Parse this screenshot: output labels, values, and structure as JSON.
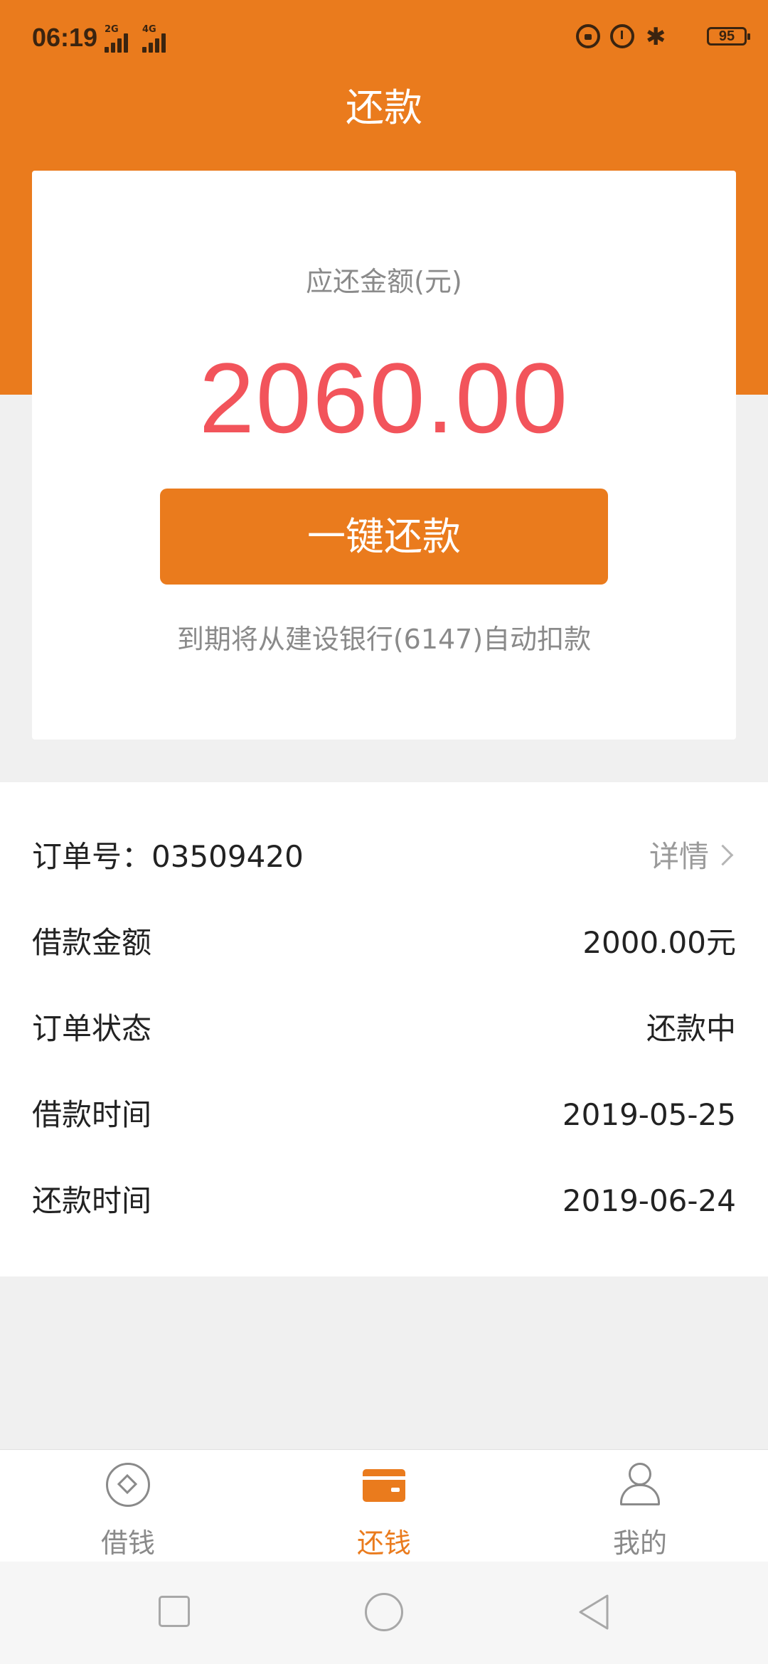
{
  "status_bar": {
    "time": "06:19",
    "signal_1_label": "2G",
    "signal_2_label": "4G",
    "battery": "95",
    "icons": [
      "lock-rotation-icon",
      "alarm-icon",
      "bluetooth-icon",
      "battery-icon"
    ]
  },
  "header": {
    "title": "还款"
  },
  "card": {
    "amount_label": "应还金额(元)",
    "amount_value": "2060.00",
    "button_label": "一键还款",
    "auto_debit_note": "到期将从建设银行(6147)自动扣款"
  },
  "order": {
    "order_no_label": "订单号：",
    "order_no": "03509420",
    "detail_link": "详情",
    "rows": [
      {
        "label": "借款金额",
        "value": "2000.00元"
      },
      {
        "label": "订单状态",
        "value": "还款中"
      },
      {
        "label": "借款时间",
        "value": "2019-05-25"
      },
      {
        "label": "还款时间",
        "value": "2019-06-24"
      }
    ]
  },
  "tabs": [
    {
      "label": "借钱",
      "icon": "borrow-coin-icon",
      "active": false
    },
    {
      "label": "还钱",
      "icon": "wallet-icon",
      "active": true
    },
    {
      "label": "我的",
      "icon": "user-icon",
      "active": false
    }
  ],
  "colors": {
    "brand_orange": "#ea7b1d",
    "amount_red": "#f2545b",
    "muted_text": "#8a8a8a"
  }
}
